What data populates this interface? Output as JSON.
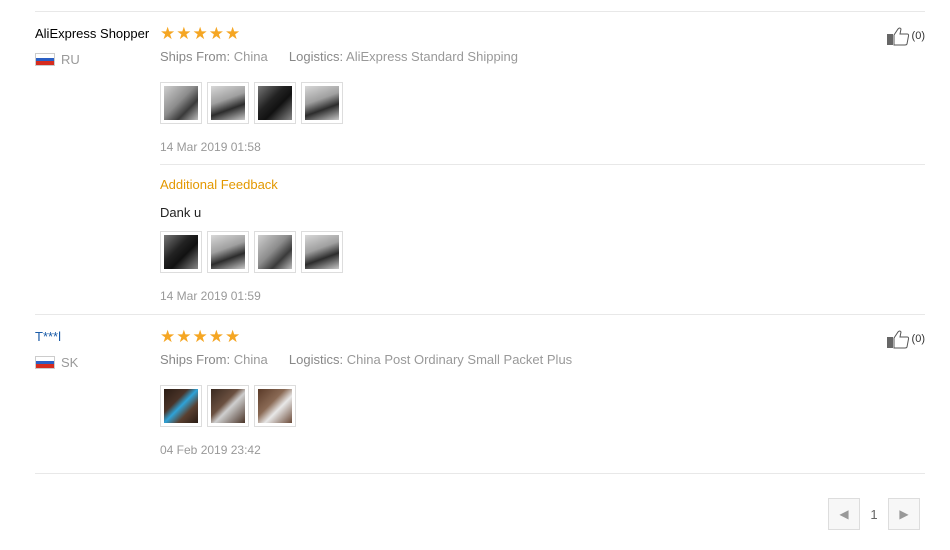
{
  "reviews": [
    {
      "user": "AliExpress Shopper",
      "country": "RU",
      "rating": 5,
      "ships_from_label": "Ships From:",
      "ships_from": "China",
      "logistics_label": "Logistics:",
      "logistics": "AliExpress Standard Shipping",
      "date": "14 Mar 2019 01:58",
      "likes": "(0)",
      "additional": {
        "label": "Additional Feedback",
        "text": "Dank u",
        "date": "14 Mar 2019 01:59"
      }
    },
    {
      "user": "T***l",
      "country": "SK",
      "rating": 5,
      "ships_from_label": "Ships From:",
      "ships_from": "China",
      "logistics_label": "Logistics:",
      "logistics": "China Post Ordinary Small Packet Plus",
      "date": "04 Feb 2019 23:42",
      "likes": "(0)"
    }
  ],
  "pagination": {
    "current": "1"
  },
  "colors": {
    "star": "#f5a623",
    "additional": "#e39800",
    "link": "#1a5ba8"
  },
  "icons": [
    "star-icon",
    "thumbs-up-icon",
    "flag-icon",
    "chevron-left-icon",
    "chevron-right-icon"
  ]
}
